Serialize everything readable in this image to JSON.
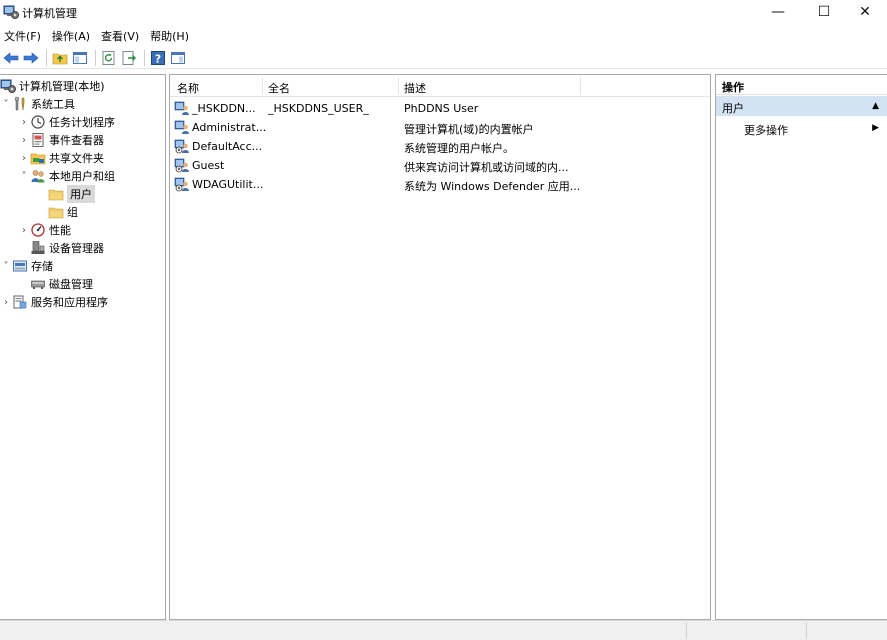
{
  "window": {
    "title": "计算机管理"
  },
  "menu": {
    "items": [
      "文件(F)",
      "操作(A)",
      "查看(V)",
      "帮助(H)"
    ]
  },
  "toolbar": {
    "icons": [
      "back-arrow-icon",
      "forward-arrow-icon",
      "up-folder-icon",
      "show-hide-console-tree-icon",
      "refresh-icon",
      "export-list-icon",
      "help-icon",
      "show-hide-action-pane-icon"
    ]
  },
  "tree": {
    "items": [
      {
        "label": "计算机管理(本地)",
        "icon": "computer-management-icon"
      },
      {
        "label": "系统工具",
        "icon": "system-tools-icon"
      },
      {
        "label": "任务计划程序",
        "icon": "clock-icon"
      },
      {
        "label": "事件查看器",
        "icon": "event-viewer-icon"
      },
      {
        "label": "共享文件夹",
        "icon": "shared-folder-icon"
      },
      {
        "label": "本地用户和组",
        "icon": "users-group-icon"
      },
      {
        "label": "用户",
        "icon": "folder-icon"
      },
      {
        "label": "组",
        "icon": "folder-icon"
      },
      {
        "label": "性能",
        "icon": "performance-icon"
      },
      {
        "label": "设备管理器",
        "icon": "device-manager-icon"
      },
      {
        "label": "存储",
        "icon": "storage-icon"
      },
      {
        "label": "磁盘管理",
        "icon": "disk-icon"
      },
      {
        "label": "服务和应用程序",
        "icon": "services-icon"
      }
    ]
  },
  "list": {
    "columns": [
      "名称",
      "全名",
      "描述"
    ],
    "rows": [
      {
        "name": "_HSKDDN...",
        "fullname": "_HSKDDNS_USER_",
        "description": "PhDDNS User"
      },
      {
        "name": "Administrat...",
        "fullname": "",
        "description": "管理计算机(域)的内置帐户"
      },
      {
        "name": "DefaultAcc...",
        "fullname": "",
        "description": "系统管理的用户帐户。"
      },
      {
        "name": "Guest",
        "fullname": "",
        "description": "供来宾访问计算机或访问域的内..."
      },
      {
        "name": "WDAGUtilit...",
        "fullname": "",
        "description": "系统为 Windows Defender 应用..."
      }
    ]
  },
  "actions": {
    "header": "操作",
    "section": "用户",
    "item": "更多操作"
  },
  "window_controls": {
    "minimize": "—",
    "maximize": "☐",
    "close": "✕"
  }
}
